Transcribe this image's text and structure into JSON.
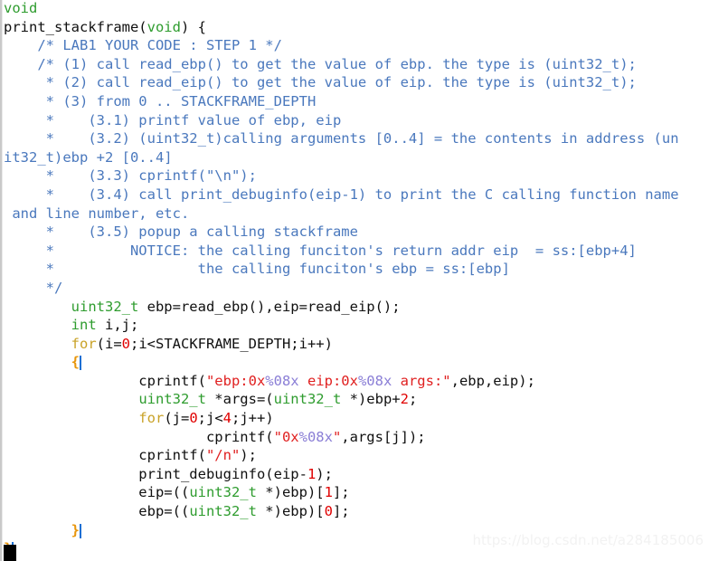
{
  "document": {
    "title": "print_stackframe",
    "language": "C",
    "watermark": "https://blog.csdn.net/a284185006"
  },
  "theme": {
    "background": "#ffffff",
    "plain": "#101010",
    "type_keyword": "#2e9c2e",
    "comment": "#4a78bd",
    "control_keyword": "#c9a227",
    "number": "#e00000",
    "string": "#e02020",
    "format_specifier": "#8a7ed6",
    "brace_match": "#e8960c",
    "caret": "#1a6fd4",
    "gutter_rule": "#c9c9c9",
    "watermark_color": "#f2f2f2"
  },
  "lines": [
    {
      "id": "l1",
      "tokens": [
        {
          "t": "void",
          "c": "t-type"
        }
      ]
    },
    {
      "id": "l2",
      "tokens": [
        {
          "t": "print_stackframe(",
          "c": "t-plain"
        },
        {
          "t": "void",
          "c": "t-type"
        },
        {
          "t": ") ",
          "c": "t-plain"
        },
        {
          "t": "{",
          "c": "t-plain"
        }
      ]
    },
    {
      "id": "l3",
      "tokens": [
        {
          "t": "    /* LAB1 YOUR CODE : STEP 1 */",
          "c": "t-comment"
        }
      ]
    },
    {
      "id": "l4",
      "tokens": [
        {
          "t": "    /* (1) call read_ebp() to get the value of ebp. the type is (uint32_t);",
          "c": "t-comment"
        }
      ]
    },
    {
      "id": "l5",
      "tokens": [
        {
          "t": "     * (2) call read_eip() to get the value of eip. the type is (uint32_t);",
          "c": "t-comment"
        }
      ]
    },
    {
      "id": "l6",
      "tokens": [
        {
          "t": "     * (3) from 0 .. STACKFRAME_DEPTH",
          "c": "t-comment"
        }
      ]
    },
    {
      "id": "l7",
      "tokens": [
        {
          "t": "     *    (3.1) printf value of ebp, eip",
          "c": "t-comment"
        }
      ]
    },
    {
      "id": "l8",
      "tokens": [
        {
          "t": "     *    (3.2) (uint32_t)calling arguments [0..4] = the contents in address (un",
          "c": "t-comment"
        }
      ]
    },
    {
      "id": "l9",
      "tokens": [
        {
          "t": "it32_t)ebp +2 [0..4]",
          "c": "t-comment"
        }
      ]
    },
    {
      "id": "l10",
      "tokens": [
        {
          "t": "     *    (3.3) cprintf(\"\\n\");",
          "c": "t-comment"
        }
      ]
    },
    {
      "id": "l11",
      "tokens": [
        {
          "t": "     *    (3.4) call print_debuginfo(eip-1) to print the C calling function name",
          "c": "t-comment"
        }
      ]
    },
    {
      "id": "l12",
      "tokens": [
        {
          "t": " and line number, etc.",
          "c": "t-comment"
        }
      ]
    },
    {
      "id": "l13",
      "tokens": [
        {
          "t": "     *    (3.5) popup a calling stackframe",
          "c": "t-comment"
        }
      ]
    },
    {
      "id": "l14",
      "tokens": [
        {
          "t": "     *         NOTICE: the calling funciton's return addr eip  = ss:[ebp+4]",
          "c": "t-comment"
        }
      ]
    },
    {
      "id": "l15",
      "tokens": [
        {
          "t": "     *                 the calling funciton's ebp = ss:[ebp]",
          "c": "t-comment"
        }
      ]
    },
    {
      "id": "l16",
      "tokens": [
        {
          "t": "     */",
          "c": "t-comment"
        }
      ]
    },
    {
      "id": "l17",
      "tokens": [
        {
          "t": "        ",
          "c": "t-plain"
        },
        {
          "t": "uint32_t",
          "c": "t-type"
        },
        {
          "t": " ebp=read_ebp(),eip=read_eip();",
          "c": "t-plain"
        }
      ]
    },
    {
      "id": "l18",
      "tokens": [
        {
          "t": "        ",
          "c": "t-plain"
        },
        {
          "t": "int",
          "c": "t-type"
        },
        {
          "t": " i,j;",
          "c": "t-plain"
        }
      ]
    },
    {
      "id": "l19",
      "tokens": [
        {
          "t": "        ",
          "c": "t-plain"
        },
        {
          "t": "for",
          "c": "t-kw"
        },
        {
          "t": "(i=",
          "c": "t-plain"
        },
        {
          "t": "0",
          "c": "t-num"
        },
        {
          "t": ";i<STACKFRAME_DEPTH;i++)",
          "c": "t-plain"
        }
      ]
    },
    {
      "id": "l20",
      "tokens": [
        {
          "t": "        ",
          "c": "t-plain"
        },
        {
          "t": "{",
          "c": "t-brace"
        }
      ]
    },
    {
      "id": "l21",
      "tokens": [
        {
          "t": "                cprintf(",
          "c": "t-plain"
        },
        {
          "t": "\"ebp:0x",
          "c": "t-str"
        },
        {
          "t": "%08x",
          "c": "t-fmt"
        },
        {
          "t": " eip:0x",
          "c": "t-str"
        },
        {
          "t": "%08x",
          "c": "t-fmt"
        },
        {
          "t": " args:\"",
          "c": "t-str"
        },
        {
          "t": ",ebp,eip);",
          "c": "t-plain"
        }
      ]
    },
    {
      "id": "l22",
      "tokens": [
        {
          "t": "                ",
          "c": "t-plain"
        },
        {
          "t": "uint32_t",
          "c": "t-type"
        },
        {
          "t": " *args=(",
          "c": "t-plain"
        },
        {
          "t": "uint32_t",
          "c": "t-type"
        },
        {
          "t": " *)ebp+",
          "c": "t-plain"
        },
        {
          "t": "2",
          "c": "t-num"
        },
        {
          "t": ";",
          "c": "t-plain"
        }
      ]
    },
    {
      "id": "l23",
      "tokens": [
        {
          "t": "                ",
          "c": "t-plain"
        },
        {
          "t": "for",
          "c": "t-kw"
        },
        {
          "t": "(j=",
          "c": "t-plain"
        },
        {
          "t": "0",
          "c": "t-num"
        },
        {
          "t": ";j<",
          "c": "t-plain"
        },
        {
          "t": "4",
          "c": "t-num"
        },
        {
          "t": ";j++)",
          "c": "t-plain"
        }
      ]
    },
    {
      "id": "l24",
      "tokens": [
        {
          "t": "                        cprintf(",
          "c": "t-plain"
        },
        {
          "t": "\"0x",
          "c": "t-str"
        },
        {
          "t": "%08x",
          "c": "t-fmt"
        },
        {
          "t": "\"",
          "c": "t-str"
        },
        {
          "t": ",args[j]);",
          "c": "t-plain"
        }
      ]
    },
    {
      "id": "l25",
      "tokens": [
        {
          "t": "                cprintf(",
          "c": "t-plain"
        },
        {
          "t": "\"/n\"",
          "c": "t-str"
        },
        {
          "t": ");",
          "c": "t-plain"
        }
      ]
    },
    {
      "id": "l26",
      "tokens": [
        {
          "t": "                print_debuginfo(eip-",
          "c": "t-plain"
        },
        {
          "t": "1",
          "c": "t-num"
        },
        {
          "t": ");",
          "c": "t-plain"
        }
      ]
    },
    {
      "id": "l27",
      "tokens": [
        {
          "t": "                eip=((",
          "c": "t-plain"
        },
        {
          "t": "uint32_t",
          "c": "t-type"
        },
        {
          "t": " *)ebp)[",
          "c": "t-plain"
        },
        {
          "t": "1",
          "c": "t-num"
        },
        {
          "t": "];",
          "c": "t-plain"
        }
      ]
    },
    {
      "id": "l28",
      "tokens": [
        {
          "t": "                ebp=((",
          "c": "t-plain"
        },
        {
          "t": "uint32_t",
          "c": "t-type"
        },
        {
          "t": " *)ebp)[",
          "c": "t-plain"
        },
        {
          "t": "0",
          "c": "t-num"
        },
        {
          "t": "];",
          "c": "t-plain"
        }
      ]
    },
    {
      "id": "l29",
      "tokens": [
        {
          "t": "        ",
          "c": "t-plain"
        },
        {
          "t": "}",
          "c": "t-brace"
        }
      ]
    },
    {
      "id": "l30",
      "tokens": [
        {
          "t": "}",
          "c": "t-brace"
        }
      ]
    }
  ]
}
